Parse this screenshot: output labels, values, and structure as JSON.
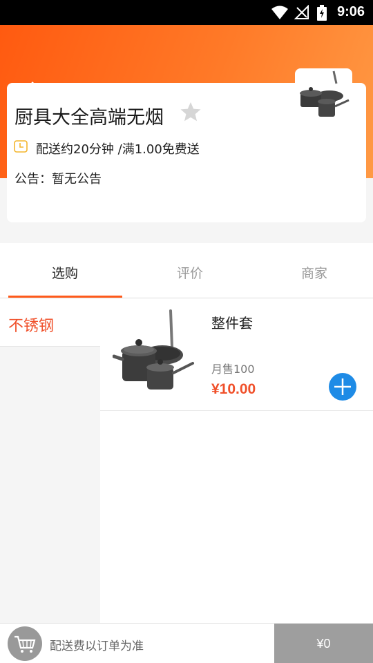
{
  "status_bar": {
    "time": "9:06"
  },
  "shop": {
    "name": "厨具大全高端无烟",
    "delivery": "配送约20分钟 /满1.00免费送",
    "notice_label": "公告：",
    "notice_text": "暂无公告"
  },
  "tabs": [
    {
      "label": "选购",
      "active": true
    },
    {
      "label": "评价",
      "active": false
    },
    {
      "label": "商家",
      "active": false
    }
  ],
  "categories": [
    {
      "label": "不锈钢",
      "selected": true
    }
  ],
  "products": [
    {
      "name": "整件套",
      "sales": "月售100",
      "price": "¥10.00"
    }
  ],
  "cart": {
    "note": "配送费以订单为准",
    "total": "¥0"
  },
  "colors": {
    "header_start": "#ff5a10",
    "header_end": "#ff9a45",
    "accent": "#f0502a",
    "add_button": "#1e8be6",
    "checkout_disabled": "#9e9e9e"
  },
  "icons": [
    "back-arrow-icon",
    "star-icon",
    "clock-icon",
    "cart-icon",
    "plus-icon",
    "wifi-icon",
    "signal-icon",
    "battery-icon"
  ]
}
